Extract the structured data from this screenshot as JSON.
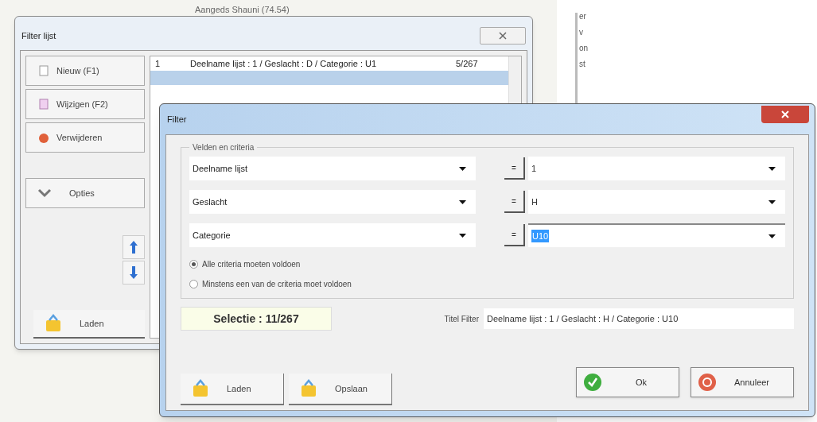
{
  "background": {
    "heading": "Aangeds Shauni (74.54)",
    "fragments": [
      "er",
      "v",
      "on",
      "st"
    ]
  },
  "list_window": {
    "title": "Filter lijst",
    "buttons": [
      {
        "label": "Nieuw (F1)",
        "kind": "new"
      },
      {
        "label": "Wijzigen (F2)",
        "kind": "edit"
      },
      {
        "label": "Verwijderen",
        "kind": "delete"
      },
      {
        "label": "Opties",
        "kind": "options"
      }
    ],
    "rows": [
      {
        "number": "1",
        "description": "Deelname lijst : 1 / Geslacht : D / Categorie : U1",
        "count": "5/267",
        "selected": false
      },
      {
        "number": "",
        "description": "",
        "count": "",
        "selected": true
      }
    ],
    "load_button": "Laden"
  },
  "filter_dialog": {
    "title": "Filter",
    "group_title": "Velden en criteria",
    "criteria": [
      {
        "field": "Deelname lijst",
        "operator": "=",
        "value": "1",
        "focused": false
      },
      {
        "field": "Geslacht",
        "operator": "=",
        "value": "H",
        "focused": false
      },
      {
        "field": "Categorie",
        "operator": "=",
        "value": "U10",
        "focused": true
      }
    ],
    "match_options": [
      {
        "label": "Alle criteria moeten voldoen",
        "selected": true
      },
      {
        "label": "Minstens een van de criteria moet voldoen",
        "selected": false
      }
    ],
    "selection": "Selectie : 11/267",
    "title_label": "Titel Filter",
    "title_value": "Deelname lijst : 1 / Geslacht : H / Categorie : U10",
    "buttons": [
      {
        "label": "Laden",
        "kind": "load"
      },
      {
        "label": "Opslaan",
        "kind": "save"
      },
      {
        "label": "Ok",
        "kind": "ok"
      },
      {
        "label": "Annuleer",
        "kind": "cancel"
      }
    ]
  }
}
